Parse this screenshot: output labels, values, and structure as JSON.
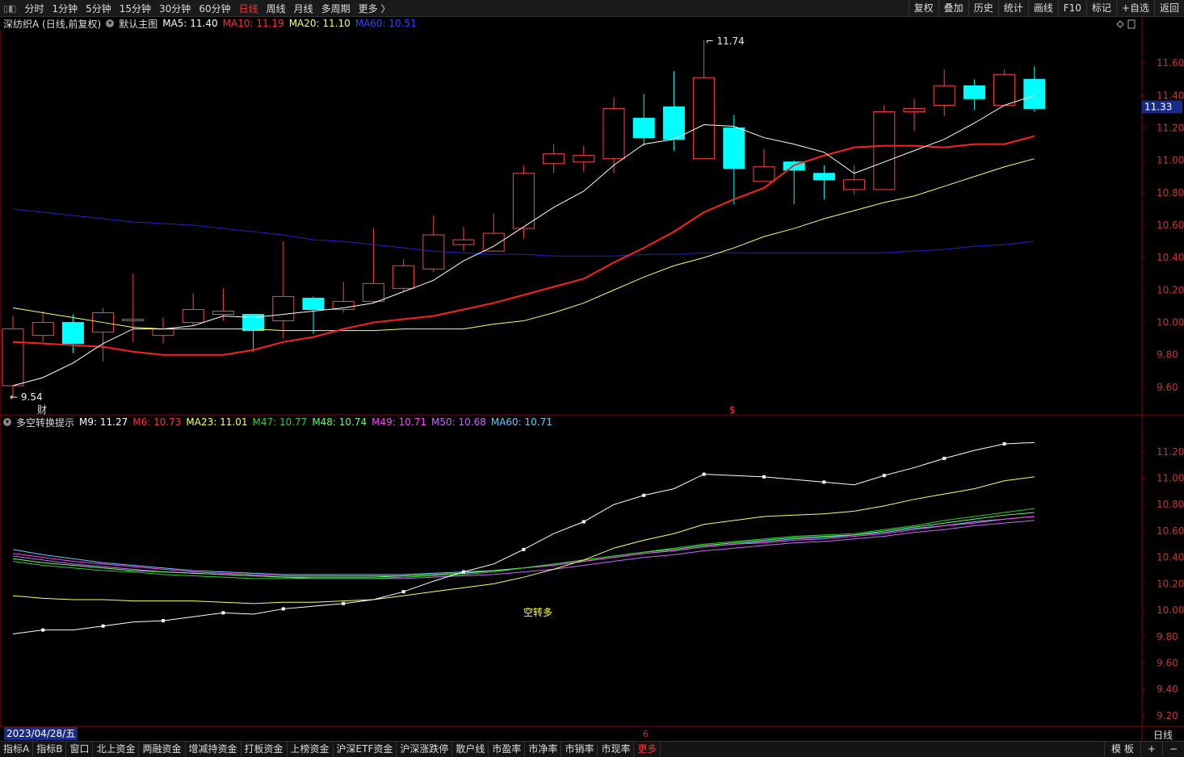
{
  "top_menu": {
    "periods": [
      "分时",
      "1分钟",
      "5分钟",
      "15分钟",
      "30分钟",
      "60分钟",
      "日线",
      "周线",
      "月线",
      "多周期",
      "更多 〉"
    ],
    "active_period": "日线",
    "tools": [
      "复权",
      "叠加",
      "历史",
      "统计",
      "画线",
      "F10",
      "标记",
      "+自选",
      "返回"
    ]
  },
  "main_header": {
    "stock": "深纺织A (日线,前复权)",
    "indicator": "默认主图",
    "ma5": "MA5: 11.40",
    "ma10": "MA10: 11.19",
    "ma20": "MA20: 11.10",
    "ma60": "MA60: 10.51"
  },
  "sub_header": {
    "indicator": "多空转换提示",
    "m9": "M9: 11.27",
    "m6": "M6: 10.73",
    "ma23": "MA23: 11.01",
    "m47": "M47: 10.77",
    "m48": "M48: 10.74",
    "m49": "M49: 10.71",
    "m50": "M50: 10.68",
    "ma60": "MA60: 10.71"
  },
  "colors": {
    "up": "#ff4444",
    "down": "#00ffff",
    "ma5": "#ffffff",
    "ma10": "#ff2020",
    "ma20": "#ffff66",
    "ma60": "#2222cc",
    "m9": "#ffffff",
    "ma23": "#ffff66",
    "m47": "#33cc33",
    "m48": "#66ff66",
    "m49": "#ff44ff",
    "m50": "#cc66ff",
    "sub_ma60": "#66ccff",
    "grid": "#8b0000"
  },
  "chart_data": [
    {
      "type": "candlestick",
      "y_ticks": [
        "11.60",
        "11.40",
        "11.20",
        "11.00",
        "10.80",
        "10.60",
        "10.40",
        "10.20",
        "10.00",
        "9.80",
        "9.60"
      ],
      "ylim": [
        9.5,
        11.8
      ],
      "current_price": "11.33",
      "high_label": "11.74",
      "low_label": "9.54",
      "finance_marker": "财",
      "dividend_marker": "$",
      "candles": [
        [
          9.61,
          9.96,
          10.04,
          9.54
        ],
        [
          9.92,
          10.0,
          10.07,
          9.88
        ],
        [
          10.0,
          9.87,
          10.05,
          9.81
        ],
        [
          9.94,
          10.06,
          10.09,
          9.76
        ],
        [
          10.01,
          10.02,
          10.3,
          9.88
        ],
        [
          9.92,
          9.96,
          10.03,
          9.87
        ],
        [
          10.0,
          10.08,
          10.18,
          9.98
        ],
        [
          10.05,
          10.07,
          10.21,
          10.01
        ],
        [
          10.05,
          9.95,
          10.05,
          9.82
        ],
        [
          10.01,
          10.16,
          10.5,
          9.9
        ],
        [
          10.15,
          10.08,
          10.16,
          9.93
        ],
        [
          10.08,
          10.13,
          10.25,
          10.06
        ],
        [
          10.13,
          10.24,
          10.58,
          10.12
        ],
        [
          10.21,
          10.35,
          10.39,
          10.19
        ],
        [
          10.33,
          10.54,
          10.66,
          10.31
        ],
        [
          10.48,
          10.51,
          10.59,
          10.44
        ],
        [
          10.44,
          10.55,
          10.67,
          10.44
        ],
        [
          10.58,
          10.92,
          10.97,
          10.52
        ],
        [
          10.98,
          11.04,
          11.1,
          10.92
        ],
        [
          10.99,
          11.03,
          11.09,
          10.93
        ],
        [
          11.01,
          11.32,
          11.39,
          10.92
        ],
        [
          11.26,
          11.14,
          11.41,
          11.09
        ],
        [
          11.33,
          11.13,
          11.55,
          11.06
        ],
        [
          11.01,
          11.51,
          11.74,
          11.01
        ],
        [
          11.2,
          10.95,
          11.28,
          10.73
        ],
        [
          10.87,
          10.96,
          11.07,
          10.87
        ],
        [
          10.99,
          10.94,
          11.0,
          10.73
        ],
        [
          10.92,
          10.88,
          10.97,
          10.76
        ],
        [
          10.82,
          10.88,
          10.97,
          10.79
        ],
        [
          10.82,
          11.3,
          11.34,
          10.82
        ],
        [
          11.3,
          11.32,
          11.38,
          11.18
        ],
        [
          11.34,
          11.46,
          11.56,
          11.27
        ],
        [
          11.46,
          11.38,
          11.5,
          11.31
        ],
        [
          11.34,
          11.53,
          11.56,
          11.34
        ],
        [
          11.5,
          11.32,
          11.58,
          11.3
        ]
      ],
      "ma5": [
        9.61,
        9.66,
        9.75,
        9.87,
        9.96,
        9.96,
        9.98,
        10.04,
        10.03,
        10.05,
        10.07,
        10.09,
        10.12,
        10.19,
        10.26,
        10.38,
        10.47,
        10.59,
        10.71,
        10.81,
        10.97,
        11.1,
        11.13,
        11.22,
        11.21,
        11.14,
        11.1,
        11.05,
        10.92,
        10.99,
        11.06,
        11.13,
        11.23,
        11.34,
        11.4
      ],
      "ma10": [
        9.88,
        9.87,
        9.86,
        9.85,
        9.82,
        9.8,
        9.8,
        9.8,
        9.83,
        9.88,
        9.91,
        9.96,
        10.0,
        10.02,
        10.04,
        10.08,
        10.12,
        10.17,
        10.22,
        10.27,
        10.37,
        10.46,
        10.56,
        10.68,
        10.76,
        10.83,
        10.97,
        11.03,
        11.08,
        11.09,
        11.09,
        11.08,
        11.1,
        11.1,
        11.15,
        11.15,
        11.19
      ],
      "ma20": [
        10.09,
        10.06,
        10.03,
        10.0,
        9.97,
        9.96,
        9.96,
        9.96,
        9.96,
        9.95,
        9.95,
        9.95,
        9.95,
        9.96,
        9.96,
        9.96,
        9.99,
        10.01,
        10.06,
        10.12,
        10.2,
        10.28,
        10.35,
        10.4,
        10.46,
        10.53,
        10.58,
        10.64,
        10.69,
        10.74,
        10.78,
        10.84,
        10.9,
        10.96,
        11.01,
        11.06,
        11.1
      ],
      "ma60": [
        10.7,
        10.68,
        10.66,
        10.64,
        10.62,
        10.61,
        10.6,
        10.58,
        10.56,
        10.54,
        10.51,
        10.5,
        10.48,
        10.46,
        10.44,
        10.43,
        10.42,
        10.42,
        10.41,
        10.41,
        10.41,
        10.42,
        10.42,
        10.43,
        10.43,
        10.43,
        10.43,
        10.43,
        10.43,
        10.43,
        10.44,
        10.45,
        10.47,
        10.48,
        10.5,
        10.51
      ]
    },
    {
      "type": "line",
      "y_ticks": [
        "11.20",
        "11.00",
        "10.80",
        "10.60",
        "10.40",
        "10.20",
        "10.00",
        "9.80",
        "9.60",
        "9.40",
        "9.20"
      ],
      "ylim": [
        9.12,
        11.37
      ],
      "annotation": "空转多",
      "series": [
        {
          "name": "M9",
          "values": [
            9.82,
            9.85,
            9.85,
            9.88,
            9.91,
            9.92,
            9.95,
            9.98,
            9.97,
            10.01,
            10.03,
            10.05,
            10.08,
            10.14,
            10.22,
            10.29,
            10.35,
            10.46,
            10.58,
            10.67,
            10.8,
            10.87,
            10.92,
            11.03,
            11.02,
            11.01,
            10.99,
            10.97,
            10.95,
            11.02,
            11.08,
            11.15,
            11.21,
            11.26,
            11.27
          ]
        },
        {
          "name": "MA23",
          "values": [
            10.11,
            10.09,
            10.08,
            10.08,
            10.07,
            10.07,
            10.07,
            10.06,
            10.05,
            10.06,
            10.06,
            10.07,
            10.08,
            10.11,
            10.14,
            10.17,
            10.2,
            10.25,
            10.31,
            10.38,
            10.47,
            10.53,
            10.58,
            10.65,
            10.68,
            10.71,
            10.72,
            10.73,
            10.75,
            10.79,
            10.84,
            10.88,
            10.92,
            10.98,
            11.01
          ]
        },
        {
          "name": "M47",
          "values": [
            10.37,
            10.34,
            10.32,
            10.3,
            10.29,
            10.27,
            10.26,
            10.25,
            10.24,
            10.24,
            10.24,
            10.24,
            10.24,
            10.25,
            10.26,
            10.27,
            10.29,
            10.32,
            10.35,
            10.38,
            10.41,
            10.44,
            10.47,
            10.5,
            10.52,
            10.54,
            10.56,
            10.57,
            10.58,
            10.61,
            10.64,
            10.68,
            10.71,
            10.74,
            10.77
          ]
        },
        {
          "name": "M48",
          "values": [
            10.39,
            10.36,
            10.34,
            10.32,
            10.3,
            10.29,
            10.28,
            10.27,
            10.26,
            10.25,
            10.25,
            10.25,
            10.25,
            10.26,
            10.27,
            10.28,
            10.3,
            10.32,
            10.35,
            10.38,
            10.41,
            10.44,
            10.46,
            10.49,
            10.51,
            10.53,
            10.55,
            10.56,
            10.57,
            10.6,
            10.63,
            10.66,
            10.69,
            10.72,
            10.74
          ]
        },
        {
          "name": "M49",
          "values": [
            10.43,
            10.4,
            10.37,
            10.35,
            10.33,
            10.31,
            10.29,
            10.28,
            10.27,
            10.26,
            10.26,
            10.26,
            10.26,
            10.26,
            10.27,
            10.28,
            10.3,
            10.32,
            10.34,
            10.37,
            10.4,
            10.43,
            10.45,
            10.48,
            10.5,
            10.51,
            10.53,
            10.54,
            10.56,
            10.58,
            10.61,
            10.64,
            10.66,
            10.69,
            10.71
          ]
        },
        {
          "name": "M50",
          "values": [
            10.41,
            10.38,
            10.35,
            10.33,
            10.31,
            10.29,
            10.28,
            10.27,
            10.26,
            10.25,
            10.24,
            10.24,
            10.24,
            10.24,
            10.25,
            10.26,
            10.27,
            10.29,
            10.31,
            10.34,
            10.37,
            10.4,
            10.42,
            10.45,
            10.47,
            10.49,
            10.51,
            10.52,
            10.54,
            10.56,
            10.59,
            10.61,
            10.64,
            10.66,
            10.68
          ]
        },
        {
          "name": "MA60",
          "values": [
            10.46,
            10.42,
            10.39,
            10.36,
            10.34,
            10.32,
            10.3,
            10.29,
            10.28,
            10.27,
            10.27,
            10.27,
            10.27,
            10.27,
            10.28,
            10.29,
            10.3,
            10.32,
            10.34,
            10.37,
            10.4,
            10.43,
            10.45,
            10.48,
            10.5,
            10.52,
            10.54,
            10.55,
            10.57,
            10.59,
            10.62,
            10.64,
            10.67,
            10.69,
            10.71
          ]
        }
      ]
    }
  ],
  "date_label": "2023/04/28/五",
  "x_tick_label": "6",
  "period_label": "日线",
  "bottom_tabs": [
    "指标A",
    "指标B",
    "窗口",
    "北上资金",
    "两融资金",
    "增减持资金",
    "打板资金",
    "上榜资金",
    "沪深ETF资金",
    "沪深涨跌停",
    "散户线",
    "市盈率",
    "市净率",
    "市销率",
    "市现率",
    "更多"
  ],
  "bottom_right": [
    "模 板",
    "+",
    "−"
  ]
}
